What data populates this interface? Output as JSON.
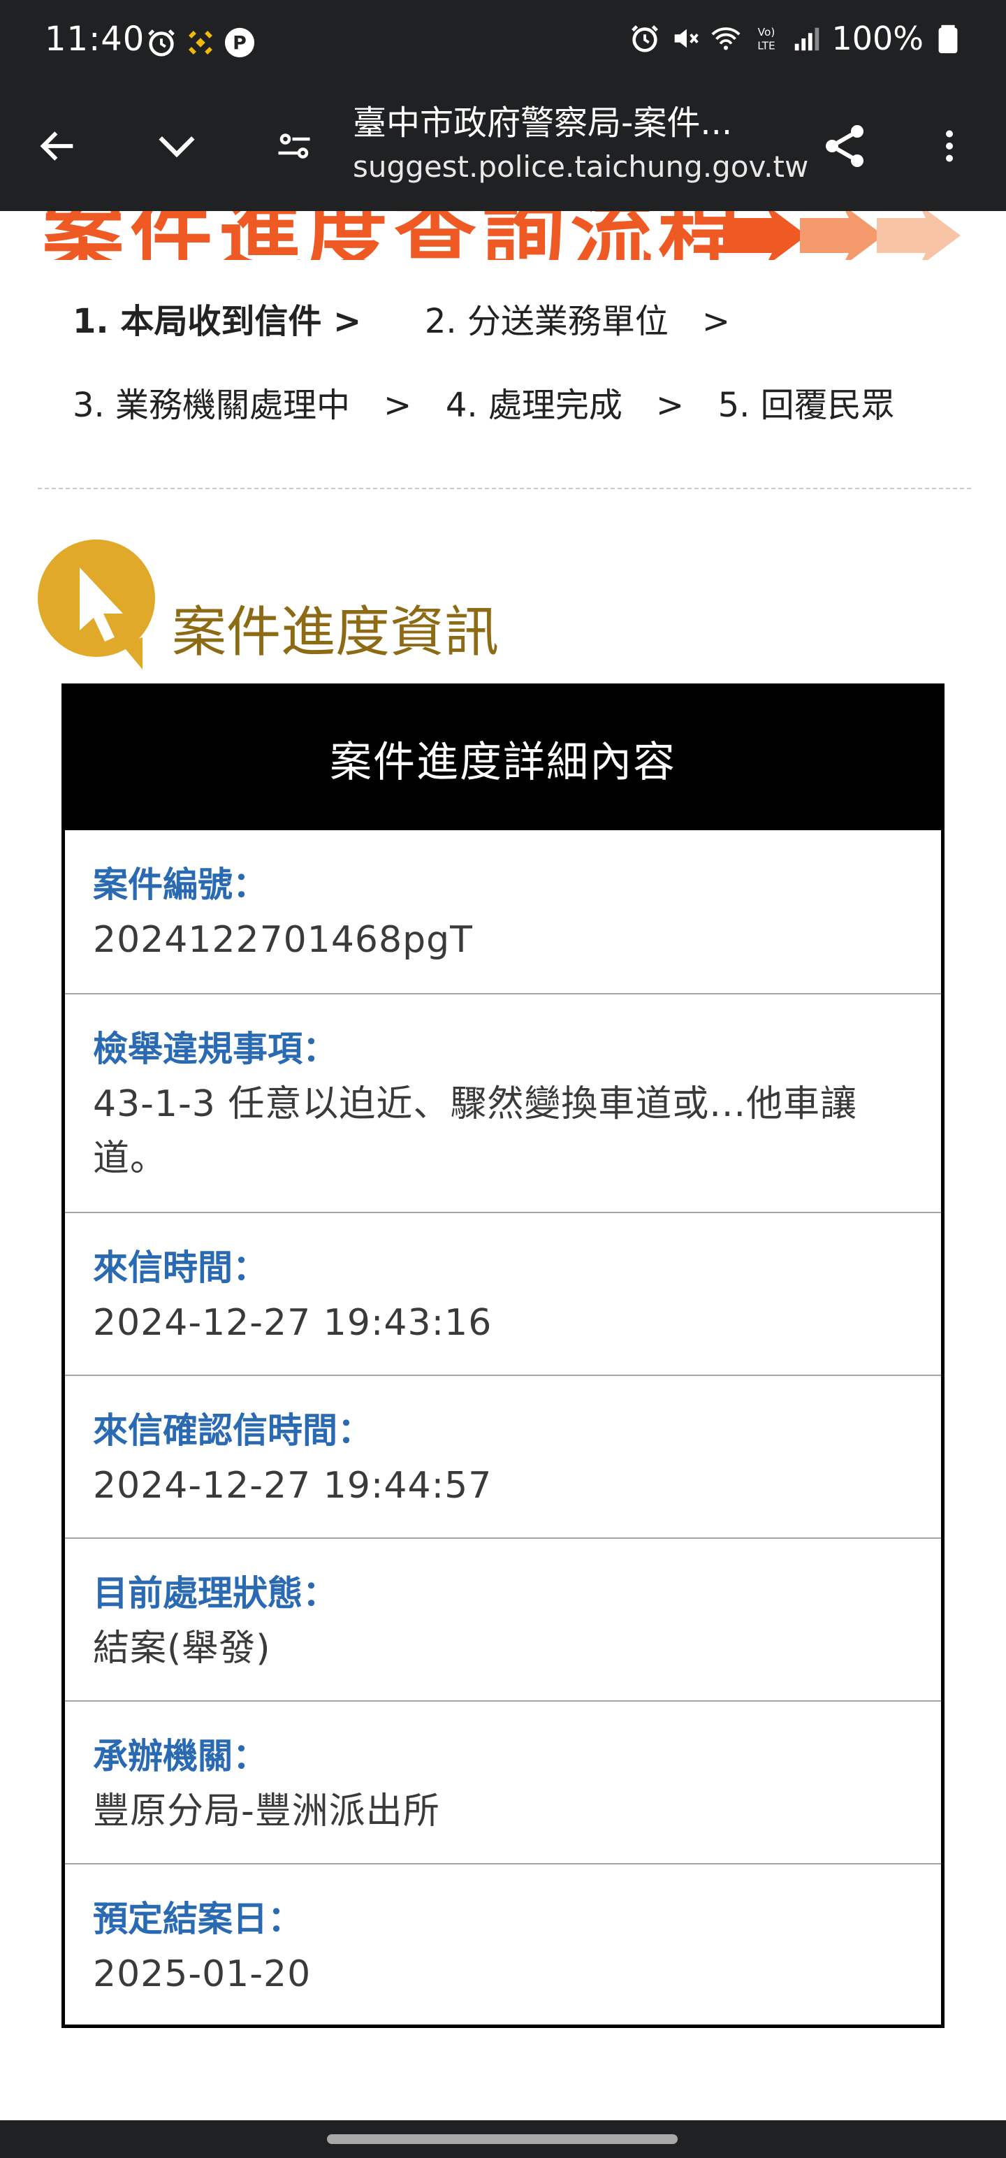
{
  "status_bar": {
    "time": "11:40",
    "battery": "100%"
  },
  "browser": {
    "title": "臺中市政府警察局-案件...",
    "url": "suggest.police.taichung.gov.tw"
  },
  "banner": {
    "title": "案件進度查詢流程"
  },
  "steps": {
    "step1": "1. 本局收到信件 >",
    "step2": "2. 分送業務單位　>",
    "step3": "3. 業務機關處理中　>",
    "step4": "4. 處理完成　>",
    "step5": "5. 回覆民眾"
  },
  "section": {
    "title": "案件進度資訊"
  },
  "card": {
    "header": "案件進度詳細內容",
    "rows": [
      {
        "label": "案件編號：",
        "value": "2024122701468pgT"
      },
      {
        "label": "檢舉違規事項：",
        "value": "43-1-3 任意以迫近、驟然變換車道或...他車讓道。"
      },
      {
        "label": "來信時間：",
        "value": "2024-12-27 19:43:16"
      },
      {
        "label": "來信確認信時間：",
        "value": "2024-12-27 19:44:57"
      },
      {
        "label": "目前處理狀態：",
        "value": "結案(舉發)"
      },
      {
        "label": "承辦機關：",
        "value": "豐原分局-豐洲派出所"
      },
      {
        "label": "預定結案日：",
        "value": "2025-01-20"
      }
    ]
  },
  "colors": {
    "bar_bg": "#1f2123",
    "banner_orange": "#ef5a24",
    "section_gold": "#8d6b14",
    "label_blue": "#2a6ab3"
  }
}
